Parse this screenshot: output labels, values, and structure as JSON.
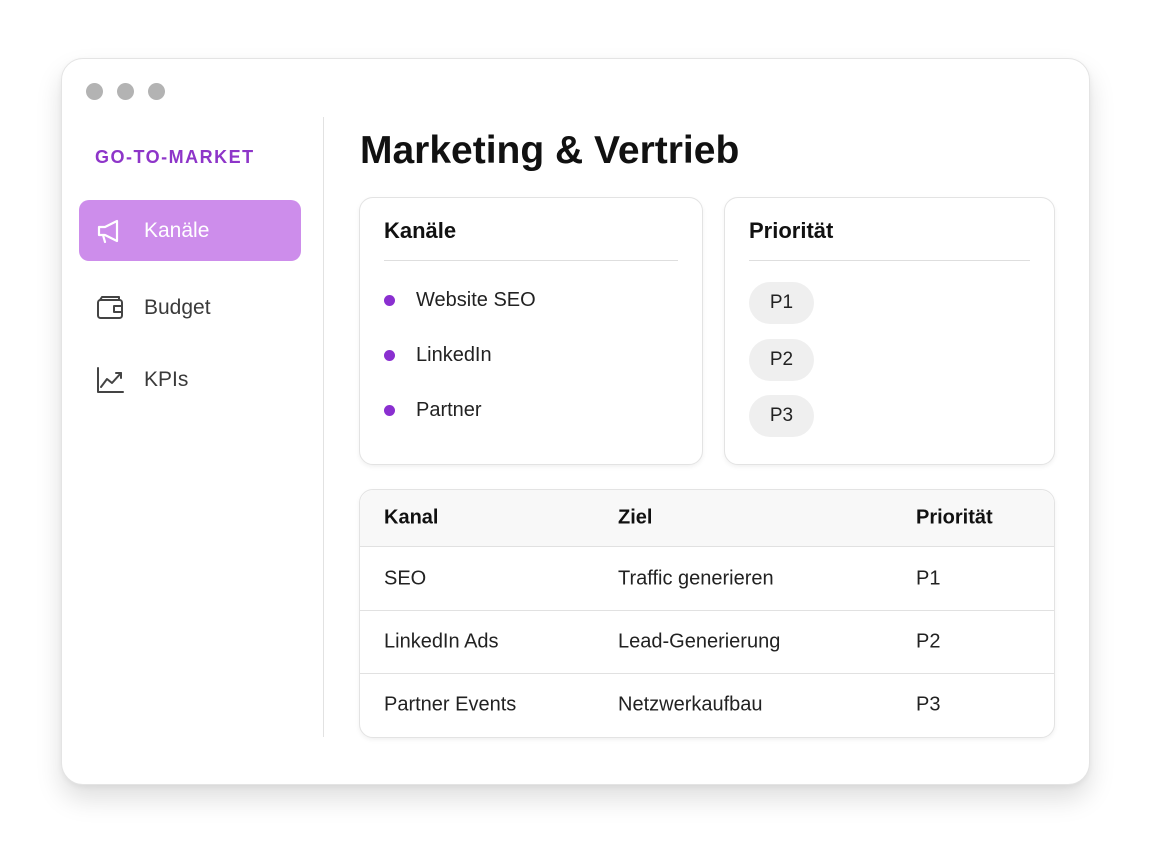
{
  "window": {
    "traffic_lights": [
      "close",
      "minimize",
      "zoom"
    ]
  },
  "sidebar": {
    "section_title": "GO-TO-MARKET",
    "items": [
      {
        "label": "Kanäle",
        "icon": "megaphone-icon",
        "active": true
      },
      {
        "label": "Budget",
        "icon": "wallet-icon",
        "active": false
      },
      {
        "label": "KPIs",
        "icon": "line-chart-icon",
        "active": false
      }
    ]
  },
  "main": {
    "title": "Marketing & Vertrieb",
    "channels_card": {
      "title": "Kanäle",
      "items": [
        "Website SEO",
        "LinkedIn",
        "Partner"
      ]
    },
    "priority_card": {
      "title": "Priorität",
      "items": [
        "P1",
        "P2",
        "P3"
      ]
    },
    "table": {
      "headers": [
        "Kanal",
        "Ziel",
        "Priorität"
      ],
      "rows": [
        [
          "SEO",
          "Traffic generieren",
          "P1"
        ],
        [
          "LinkedIn Ads",
          "Lead-Generierung",
          "P2"
        ],
        [
          "Partner Events",
          "Netzwerkaufbau",
          "P3"
        ]
      ]
    }
  },
  "colors": {
    "accent": "#8e35c9",
    "active_nav_bg": "#cd8deb",
    "bullet": "#8a2fd0",
    "pill_bg": "#efefef"
  }
}
